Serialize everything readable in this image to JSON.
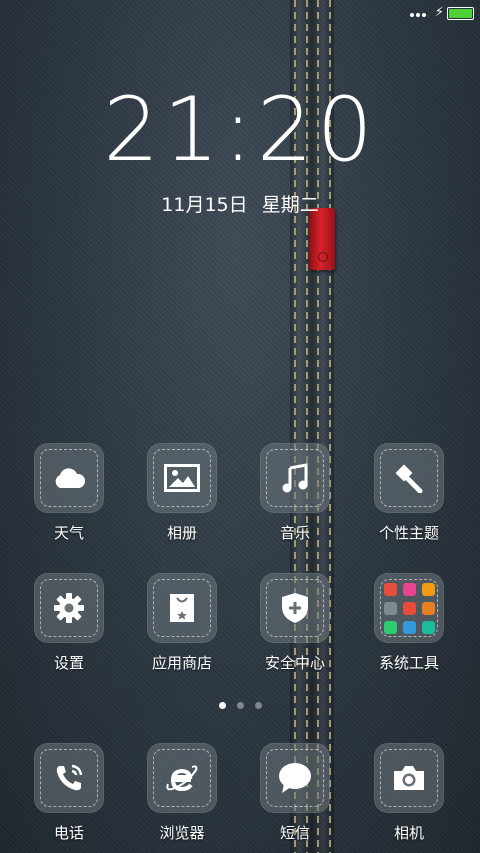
{
  "status_bar": {
    "charging": true,
    "battery_level": 1.0,
    "battery_color": "#4cd137"
  },
  "lockclock": {
    "time": "21:20",
    "date": "11月15日 星期二"
  },
  "apps_row1": [
    {
      "label": "天气",
      "icon": "cloud-icon"
    },
    {
      "label": "相册",
      "icon": "picture-icon"
    },
    {
      "label": "音乐",
      "icon": "music-note-icon"
    },
    {
      "label": "个性主题",
      "icon": "brush-icon"
    }
  ],
  "apps_row2": [
    {
      "label": "设置",
      "icon": "gear-icon"
    },
    {
      "label": "应用商店",
      "icon": "shopping-bag-icon"
    },
    {
      "label": "安全中心",
      "icon": "shield-icon"
    },
    {
      "label": "系统工具",
      "icon": "folder-icon"
    }
  ],
  "dock": [
    {
      "label": "电话",
      "icon": "phone-icon"
    },
    {
      "label": "浏览器",
      "icon": "browser-icon"
    },
    {
      "label": "短信",
      "icon": "chat-bubble-icon"
    },
    {
      "label": "相机",
      "icon": "camera-icon"
    }
  ],
  "pager": {
    "pages": 3,
    "current": 1
  },
  "folder_colors": [
    "#e74c3c",
    "#e84393",
    "#f39c12",
    "#7f8c8d",
    "#e74c3c",
    "#e67e22",
    "#2ecc71",
    "#3498db",
    "#1abc9c"
  ],
  "accent_tag_color": "#d8222b"
}
